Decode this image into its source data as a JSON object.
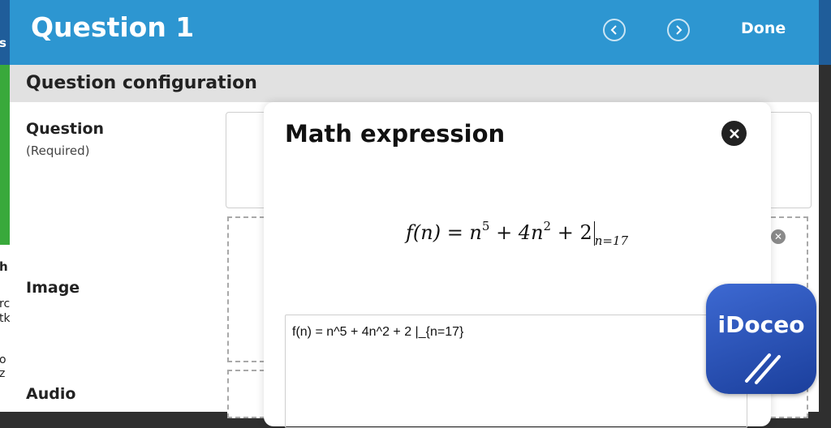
{
  "header": {
    "title": "Question 1",
    "done_label": "Done"
  },
  "section": {
    "title": "Question configuration"
  },
  "fields": {
    "question_label": "Question",
    "question_required": "(Required)",
    "image_label": "Image",
    "audio_label": "Audio"
  },
  "modal": {
    "title": "Math expression",
    "rendered": {
      "base": "f(n) = n",
      "exp5": "5",
      "mid": " + 4n",
      "exp2": "2",
      "tail": " + 2",
      "sub": "n=17"
    },
    "input_value": "f(n) = n^5 + 4n^2 + 2 |_{n=17}"
  },
  "logo": {
    "text": "iDoceo"
  },
  "edge_text": [
    "s",
    "h",
    "rc",
    "tk",
    "o",
    "z"
  ],
  "colors": {
    "header": "#2d96d1",
    "section_bar": "#e1e1e1",
    "logo": "#2a52b8"
  }
}
